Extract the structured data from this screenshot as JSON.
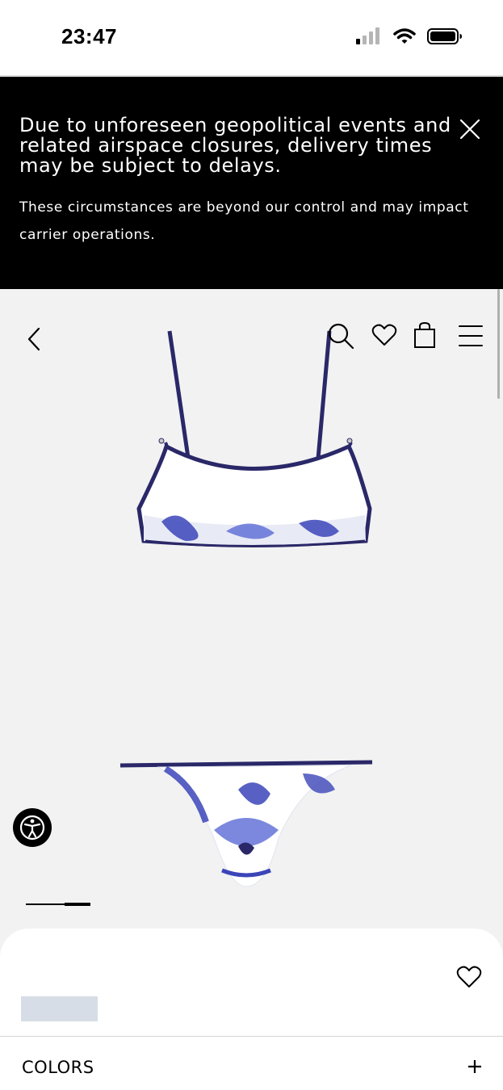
{
  "status_bar": {
    "time": "23:47",
    "icons": [
      "cellular-signal-icon",
      "wifi-icon",
      "battery-icon"
    ]
  },
  "banner": {
    "title": "Due to unforeseen geopolitical events and related airspace closures, delivery times may be subject to delays.",
    "body": "These circumstances are beyond our control and may impact carrier operations.",
    "close_icon": "close-icon"
  },
  "header": {
    "icons": [
      "back-chevron-icon",
      "search-icon",
      "heart-icon",
      "shopping-bag-icon",
      "menu-icon"
    ]
  },
  "gallery": {
    "images": [
      "bikini-top-image",
      "bikini-bottom-image"
    ],
    "pagination": {
      "current": 2,
      "total": 2
    }
  },
  "accessibility": {
    "icon": "accessibility-icon"
  },
  "product_panel": {
    "wishlist_icon": "heart-icon",
    "colors_label": "COLORS",
    "expand_icon": "plus-icon"
  },
  "colors": {
    "banner_bg": "#000000",
    "page_bg": "#f2f2f2",
    "print_blue": "#3b45b8",
    "trim_navy": "#2a2868"
  }
}
